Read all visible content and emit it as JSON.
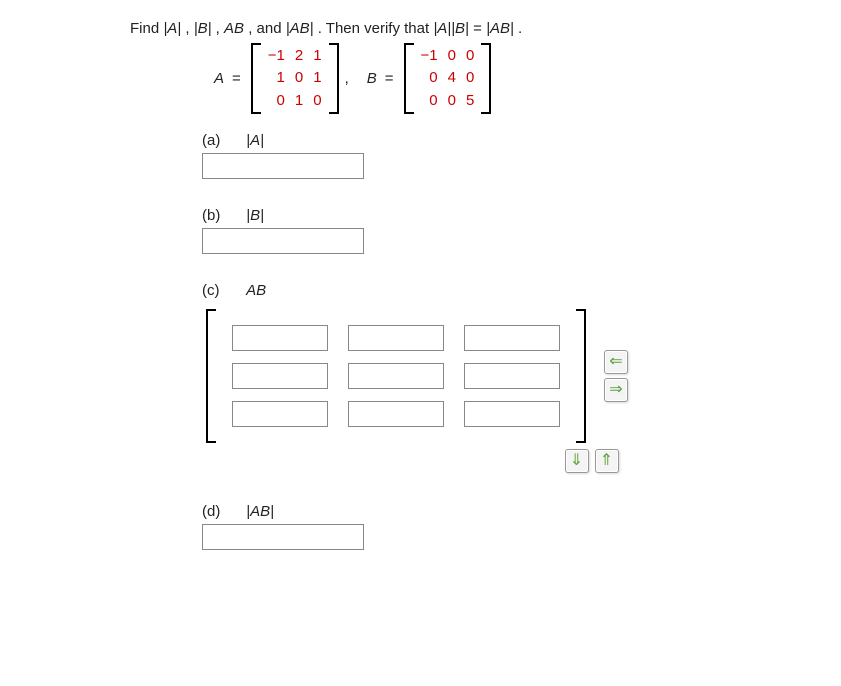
{
  "question": {
    "prefix": "Find ",
    "t1": "|A|",
    "sep1": ", ",
    "t2": "|B|",
    "sep2": ", ",
    "t3": "AB",
    "sep3": ", and ",
    "t4": "|AB|",
    "mid": ". Then verify that ",
    "t5": "|A||B|",
    "eq": " = ",
    "t6": "|AB|",
    "suffix": "."
  },
  "A_label": "A",
  "B_label": "B",
  "equals": "=",
  "comma": ",",
  "matrixA": [
    [
      "−1",
      "2",
      "1"
    ],
    [
      "1",
      "0",
      "1"
    ],
    [
      "0",
      "1",
      "0"
    ]
  ],
  "matrixB": [
    [
      "−1",
      "0",
      "0"
    ],
    [
      "0",
      "4",
      "0"
    ],
    [
      "0",
      "0",
      "5"
    ]
  ],
  "parts": {
    "a": {
      "letter": "(a)",
      "label": "|A|"
    },
    "b": {
      "letter": "(b)",
      "label": "|B|"
    },
    "c": {
      "letter": "(c)",
      "label": "AB"
    },
    "d": {
      "letter": "(d)",
      "label": "|AB|"
    }
  },
  "arrow_glyphs": {
    "left": "⇐",
    "right": "⇒",
    "down": "⇓",
    "up": "⇑"
  }
}
